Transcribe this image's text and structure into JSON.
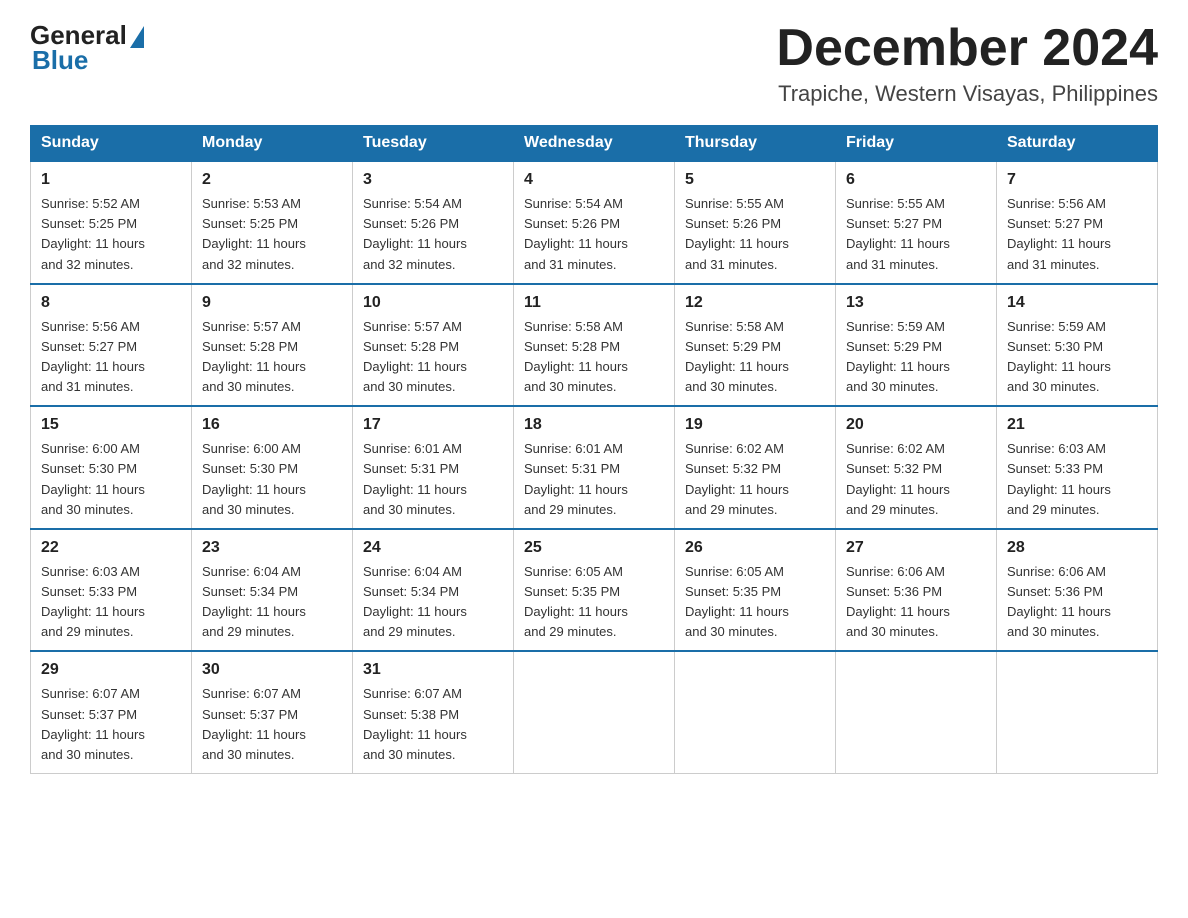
{
  "logo": {
    "general": "General",
    "blue": "Blue"
  },
  "header": {
    "month": "December 2024",
    "location": "Trapiche, Western Visayas, Philippines"
  },
  "days_of_week": [
    "Sunday",
    "Monday",
    "Tuesday",
    "Wednesday",
    "Thursday",
    "Friday",
    "Saturday"
  ],
  "weeks": [
    [
      {
        "day": "1",
        "sunrise": "5:52 AM",
        "sunset": "5:25 PM",
        "daylight": "11 hours and 32 minutes."
      },
      {
        "day": "2",
        "sunrise": "5:53 AM",
        "sunset": "5:25 PM",
        "daylight": "11 hours and 32 minutes."
      },
      {
        "day": "3",
        "sunrise": "5:54 AM",
        "sunset": "5:26 PM",
        "daylight": "11 hours and 32 minutes."
      },
      {
        "day": "4",
        "sunrise": "5:54 AM",
        "sunset": "5:26 PM",
        "daylight": "11 hours and 31 minutes."
      },
      {
        "day": "5",
        "sunrise": "5:55 AM",
        "sunset": "5:26 PM",
        "daylight": "11 hours and 31 minutes."
      },
      {
        "day": "6",
        "sunrise": "5:55 AM",
        "sunset": "5:27 PM",
        "daylight": "11 hours and 31 minutes."
      },
      {
        "day": "7",
        "sunrise": "5:56 AM",
        "sunset": "5:27 PM",
        "daylight": "11 hours and 31 minutes."
      }
    ],
    [
      {
        "day": "8",
        "sunrise": "5:56 AM",
        "sunset": "5:27 PM",
        "daylight": "11 hours and 31 minutes."
      },
      {
        "day": "9",
        "sunrise": "5:57 AM",
        "sunset": "5:28 PM",
        "daylight": "11 hours and 30 minutes."
      },
      {
        "day": "10",
        "sunrise": "5:57 AM",
        "sunset": "5:28 PM",
        "daylight": "11 hours and 30 minutes."
      },
      {
        "day": "11",
        "sunrise": "5:58 AM",
        "sunset": "5:28 PM",
        "daylight": "11 hours and 30 minutes."
      },
      {
        "day": "12",
        "sunrise": "5:58 AM",
        "sunset": "5:29 PM",
        "daylight": "11 hours and 30 minutes."
      },
      {
        "day": "13",
        "sunrise": "5:59 AM",
        "sunset": "5:29 PM",
        "daylight": "11 hours and 30 minutes."
      },
      {
        "day": "14",
        "sunrise": "5:59 AM",
        "sunset": "5:30 PM",
        "daylight": "11 hours and 30 minutes."
      }
    ],
    [
      {
        "day": "15",
        "sunrise": "6:00 AM",
        "sunset": "5:30 PM",
        "daylight": "11 hours and 30 minutes."
      },
      {
        "day": "16",
        "sunrise": "6:00 AM",
        "sunset": "5:30 PM",
        "daylight": "11 hours and 30 minutes."
      },
      {
        "day": "17",
        "sunrise": "6:01 AM",
        "sunset": "5:31 PM",
        "daylight": "11 hours and 30 minutes."
      },
      {
        "day": "18",
        "sunrise": "6:01 AM",
        "sunset": "5:31 PM",
        "daylight": "11 hours and 29 minutes."
      },
      {
        "day": "19",
        "sunrise": "6:02 AM",
        "sunset": "5:32 PM",
        "daylight": "11 hours and 29 minutes."
      },
      {
        "day": "20",
        "sunrise": "6:02 AM",
        "sunset": "5:32 PM",
        "daylight": "11 hours and 29 minutes."
      },
      {
        "day": "21",
        "sunrise": "6:03 AM",
        "sunset": "5:33 PM",
        "daylight": "11 hours and 29 minutes."
      }
    ],
    [
      {
        "day": "22",
        "sunrise": "6:03 AM",
        "sunset": "5:33 PM",
        "daylight": "11 hours and 29 minutes."
      },
      {
        "day": "23",
        "sunrise": "6:04 AM",
        "sunset": "5:34 PM",
        "daylight": "11 hours and 29 minutes."
      },
      {
        "day": "24",
        "sunrise": "6:04 AM",
        "sunset": "5:34 PM",
        "daylight": "11 hours and 29 minutes."
      },
      {
        "day": "25",
        "sunrise": "6:05 AM",
        "sunset": "5:35 PM",
        "daylight": "11 hours and 29 minutes."
      },
      {
        "day": "26",
        "sunrise": "6:05 AM",
        "sunset": "5:35 PM",
        "daylight": "11 hours and 30 minutes."
      },
      {
        "day": "27",
        "sunrise": "6:06 AM",
        "sunset": "5:36 PM",
        "daylight": "11 hours and 30 minutes."
      },
      {
        "day": "28",
        "sunrise": "6:06 AM",
        "sunset": "5:36 PM",
        "daylight": "11 hours and 30 minutes."
      }
    ],
    [
      {
        "day": "29",
        "sunrise": "6:07 AM",
        "sunset": "5:37 PM",
        "daylight": "11 hours and 30 minutes."
      },
      {
        "day": "30",
        "sunrise": "6:07 AM",
        "sunset": "5:37 PM",
        "daylight": "11 hours and 30 minutes."
      },
      {
        "day": "31",
        "sunrise": "6:07 AM",
        "sunset": "5:38 PM",
        "daylight": "11 hours and 30 minutes."
      },
      null,
      null,
      null,
      null
    ]
  ],
  "labels": {
    "sunrise": "Sunrise:",
    "sunset": "Sunset:",
    "daylight": "Daylight:"
  }
}
